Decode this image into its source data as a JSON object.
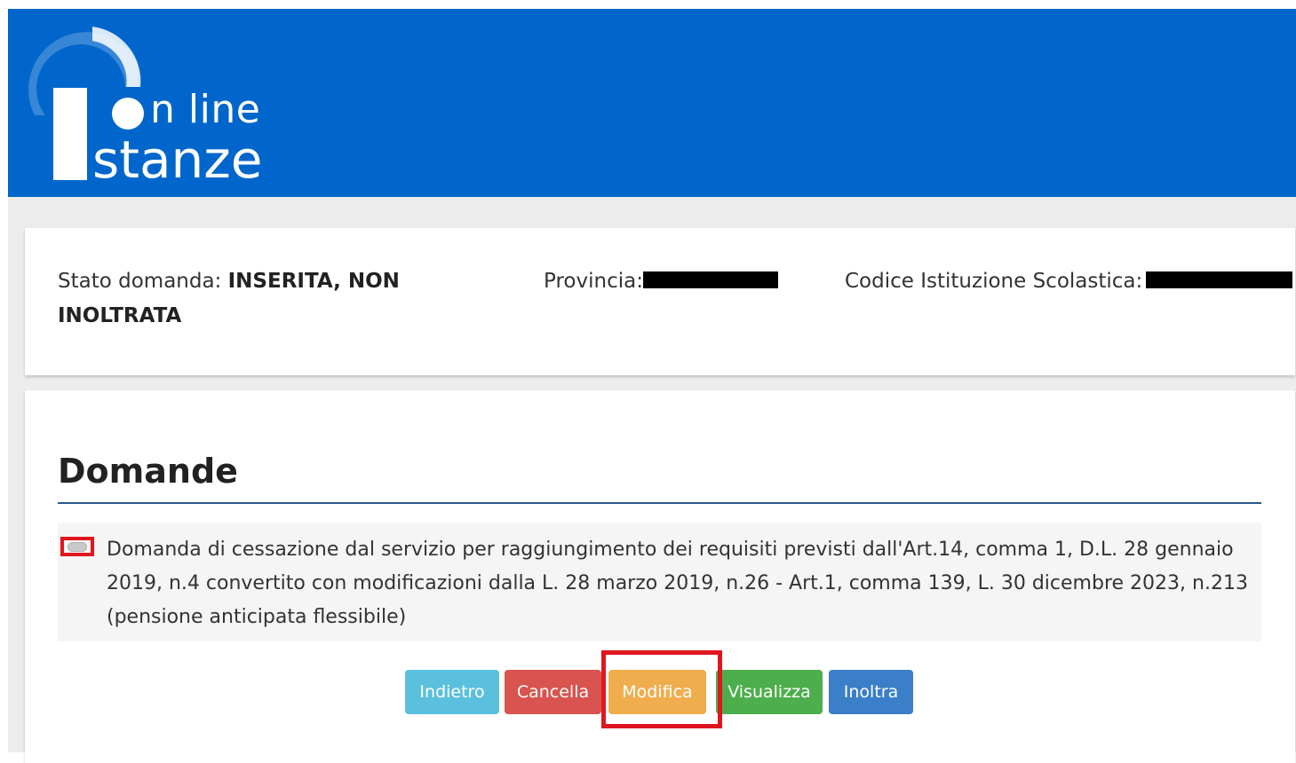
{
  "header": {
    "logo_online": "On line",
    "logo_istanze": "Istanze",
    "logo_online_visible": "n line",
    "logo_istanze_visible": "stanze",
    "brand_color": "#0066cc"
  },
  "info": {
    "stato_label": "Stato domanda: ",
    "stato_value": "INSERITA, NON INOLTRATA",
    "provincia_label": "Provincia:",
    "codice_label": "Codice Istituzione Scolastica:"
  },
  "domande": {
    "title": "Domande",
    "item_text": "Domanda di cessazione dal servizio per raggiungimento dei requisiti previsti dall'Art.14, comma 1, D.L. 28 gennaio 2019, n.4 convertito con modificazioni dalla L. 28 marzo 2019, n.26 - Art.1, comma 139, L. 30 dicembre 2023, n.213 (pensione anticipata flessibile)"
  },
  "buttons": {
    "indietro": "Indietro",
    "cancella": "Cancella",
    "modifica": "Modifica",
    "visualizza": "Visualizza",
    "inoltra": "Inoltra"
  },
  "colors": {
    "indietro": "#5bc0de",
    "cancella": "#d9534f",
    "modifica": "#f0ad4e",
    "visualizza": "#4cae4c",
    "inoltra": "#3a7fc7",
    "highlight": "#e0161e"
  }
}
